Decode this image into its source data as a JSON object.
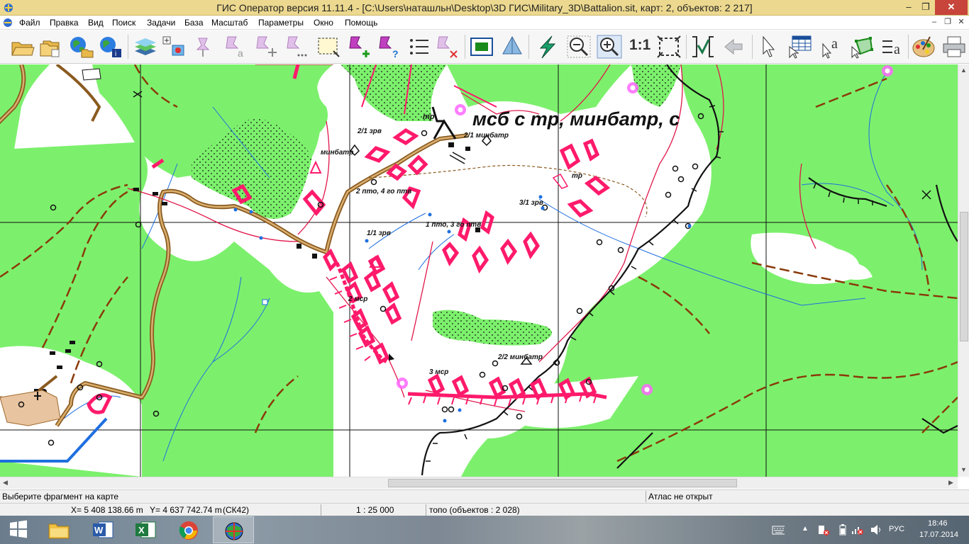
{
  "window": {
    "title": "ГИС Оператор версия 11.11.4 - [C:\\Users\\наташльн\\Desktop\\3D ГИС\\Military_3D\\Battalion.sit, карт: 2, объектов: 2 217]",
    "minimize": "–",
    "maximize": "❐",
    "close": "✕"
  },
  "menu": {
    "items": [
      "Файл",
      "Правка",
      "Вид",
      "Поиск",
      "Задачи",
      "База",
      "Масштаб",
      "Параметры",
      "Окно",
      "Помощь"
    ],
    "mdi_minimize": "–",
    "mdi_restore": "❐",
    "mdi_close": "✕"
  },
  "toolbar": {
    "scale_1_1": "1:1",
    "icons": [
      "open-folder-icon",
      "open-multiple-icon",
      "globe-open-icon",
      "globe-info-icon",
      "layers-icon",
      "select-object-icon",
      "pin-select-icon",
      "pin-text-icon",
      "pin-move-icon",
      "pin-dots-icon",
      "frame-select-icon",
      "pin-add-icon",
      "pin-query-icon",
      "list-icon",
      "pin-delete-icon",
      "map-window-icon",
      "3d-view-icon",
      "lightning-icon",
      "zoom-out-icon",
      "zoom-in-icon",
      "scale-1-1-icon",
      "fit-window-icon",
      "check-icon",
      "back-arrow-icon",
      "pointer-icon",
      "table-icon",
      "text-cursor-icon",
      "polygon-icon",
      "list-text-icon",
      "palette-icon",
      "printer-icon"
    ]
  },
  "map": {
    "title_label": "мсб с тр, минбатр, с",
    "labels": [
      {
        "text": "тр",
        "key": "tr1"
      },
      {
        "text": "2/1 зрв"
      },
      {
        "text": "2/1 минбатр"
      },
      {
        "text": "минбатр"
      },
      {
        "text": "тр"
      },
      {
        "text": "2 пто, 4 го птв"
      },
      {
        "text": "3/1 зрв"
      },
      {
        "text": "1/1 зрв"
      },
      {
        "text": "1 пто, 3 го птв"
      },
      {
        "text": "2 мср"
      },
      {
        "text": "2/2 минбатр"
      },
      {
        "text": "3 мср"
      }
    ]
  },
  "status": {
    "hint": "Выберите фрагмент на карте",
    "atlas": "Атлас не открыт",
    "coord_x": "X= 5 408 138.66 m",
    "coord_y": "Y= 4 637 742.74 m",
    "crs": "(СК42)",
    "scale": "1 : 25 000",
    "layer": "топо   (объектов : 2 028)"
  },
  "taskbar": {
    "apps": [
      "file-explorer-icon",
      "word-icon",
      "excel-icon",
      "chrome-icon",
      "gis-operator-icon"
    ],
    "lang": "РУС",
    "time": "18:46",
    "date": "17.07.2014"
  },
  "colors": {
    "titlebar": "#ecd98f",
    "forest": "#7cf06c",
    "tactical": "#ff1a6b",
    "road": "#a06a30",
    "water": "#1e6fe0",
    "trench": "#111111"
  }
}
